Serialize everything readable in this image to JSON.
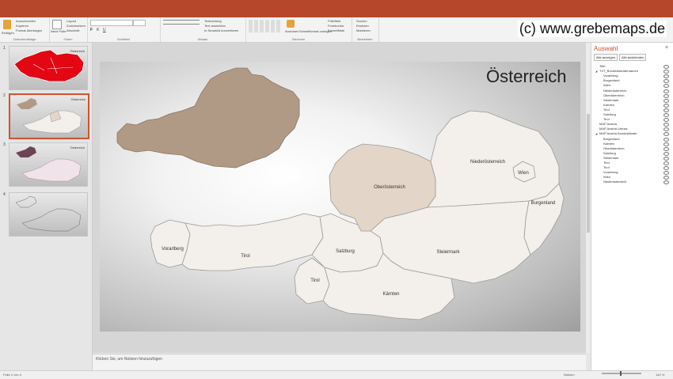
{
  "ribbon": {
    "clipboard": {
      "paste": "Einfügen",
      "cut": "Ausschneiden",
      "copy": "Kopieren",
      "format_painter": "Format übertragen",
      "group": "Zwischenablage"
    },
    "slides": {
      "new_slide": "Neue Folie",
      "layout": "Layout",
      "reset": "Zurücksetzen",
      "section": "Abschnitt",
      "group": "Folien"
    },
    "font": {
      "group": "Schriftart"
    },
    "paragraph": {
      "text_direction": "Textrichtung",
      "align_text": "Text ausrichten",
      "smartart": "In SmartArt konvertieren",
      "group": "Absatz"
    },
    "drawing": {
      "arrange": "Anordnen",
      "quick_styles": "Schnellformat-vorlagen",
      "fill": "Fülleffekt",
      "outline": "Formkontur",
      "effects": "Formeffekte",
      "group": "Zeichnen"
    },
    "editing": {
      "find": "Suchen",
      "replace": "Ersetzen",
      "select": "Markieren",
      "group": "Bearbeiten"
    }
  },
  "watermark": "(c) www.grebemaps.de",
  "thumbnails": [
    {
      "num": "1",
      "title": "Österreich"
    },
    {
      "num": "2",
      "title": "Österreich"
    },
    {
      "num": "3",
      "title": "Österreich"
    },
    {
      "num": "4",
      "title": ""
    }
  ],
  "slide": {
    "title": "Österreich",
    "states": {
      "vorarlberg": "Vorarlberg",
      "tirol": "Tirol",
      "osttirol": "Tirol",
      "salzburg": "Salzburg",
      "oberoesterreich": "Oberösterreich",
      "niederoesterreich": "Niederösterreich",
      "wien": "Wien",
      "burgenland": "Burgenland",
      "steiermark": "Steiermark",
      "kaernten": "Kärnten"
    }
  },
  "notes_placeholder": "Klicken Sie, um Notizen hinzuzufügen",
  "status": {
    "slide_info": "Folie 2 von 4",
    "notes": "Notizen",
    "zoom": "142 %"
  },
  "selection_pane": {
    "title": "Auswahl",
    "show_all": "Alle anzeigen",
    "hide_all": "Alle ausblenden",
    "items": [
      {
        "label": "Titel",
        "level": 0
      },
      {
        "label": "TXT_Bundeslaendernamen",
        "level": 0,
        "group": true
      },
      {
        "label": "Vorarlberg",
        "level": 1
      },
      {
        "label": "Burgenland",
        "level": 1
      },
      {
        "label": "Wien",
        "level": 1
      },
      {
        "label": "Niederösterreich",
        "level": 1
      },
      {
        "label": "Oberösterreich",
        "level": 1
      },
      {
        "label": "Steiermark",
        "level": 1
      },
      {
        "label": "Kärnten",
        "level": 1
      },
      {
        "label": "Tirol",
        "level": 1
      },
      {
        "label": "Salzburg",
        "level": 1
      },
      {
        "label": "Tirol",
        "level": 1
      },
      {
        "label": "MAP Austria",
        "level": 0
      },
      {
        "label": "MAP Austria Umriss",
        "level": 0
      },
      {
        "label": "MAP Austria Bundesländer",
        "level": 0,
        "group": true
      },
      {
        "label": "Burgenland",
        "level": 1
      },
      {
        "label": "Kärnten",
        "level": 1
      },
      {
        "label": "Oberösterreich",
        "level": 1
      },
      {
        "label": "Salzburg",
        "level": 1
      },
      {
        "label": "Steiermark",
        "level": 1
      },
      {
        "label": "Tirol",
        "level": 1
      },
      {
        "label": "Tirol",
        "level": 1
      },
      {
        "label": "Vorarlberg",
        "level": 1
      },
      {
        "label": "Wien",
        "level": 1
      },
      {
        "label": "Niederösterreich",
        "level": 1
      }
    ]
  },
  "colors": {
    "accent": "#b7472a",
    "map_fill": "#f3efea",
    "highlight_fill": "#e3d6c8",
    "silhouette": "#b09a85"
  }
}
